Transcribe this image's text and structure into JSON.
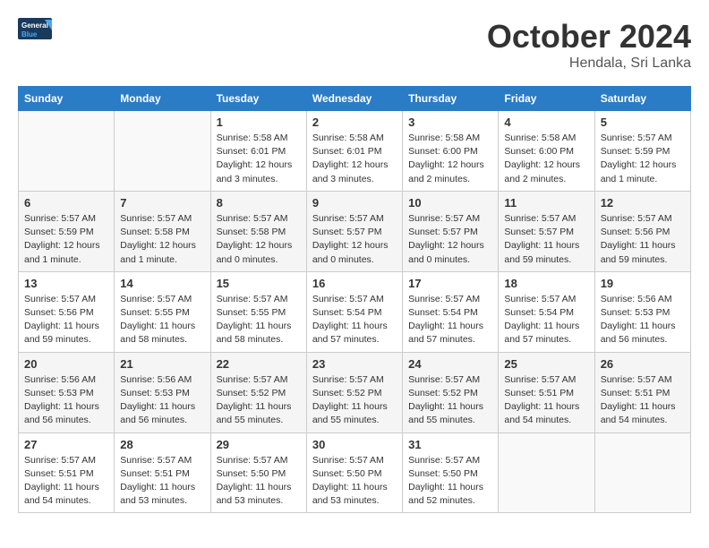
{
  "header": {
    "logo_line1": "General",
    "logo_line2": "Blue",
    "month": "October 2024",
    "location": "Hendala, Sri Lanka"
  },
  "days_of_week": [
    "Sunday",
    "Monday",
    "Tuesday",
    "Wednesday",
    "Thursday",
    "Friday",
    "Saturday"
  ],
  "weeks": [
    [
      {
        "day": "",
        "info": ""
      },
      {
        "day": "",
        "info": ""
      },
      {
        "day": "1",
        "info": "Sunrise: 5:58 AM\nSunset: 6:01 PM\nDaylight: 12 hours\nand 3 minutes."
      },
      {
        "day": "2",
        "info": "Sunrise: 5:58 AM\nSunset: 6:01 PM\nDaylight: 12 hours\nand 3 minutes."
      },
      {
        "day": "3",
        "info": "Sunrise: 5:58 AM\nSunset: 6:00 PM\nDaylight: 12 hours\nand 2 minutes."
      },
      {
        "day": "4",
        "info": "Sunrise: 5:58 AM\nSunset: 6:00 PM\nDaylight: 12 hours\nand 2 minutes."
      },
      {
        "day": "5",
        "info": "Sunrise: 5:57 AM\nSunset: 5:59 PM\nDaylight: 12 hours\nand 1 minute."
      }
    ],
    [
      {
        "day": "6",
        "info": "Sunrise: 5:57 AM\nSunset: 5:59 PM\nDaylight: 12 hours\nand 1 minute."
      },
      {
        "day": "7",
        "info": "Sunrise: 5:57 AM\nSunset: 5:58 PM\nDaylight: 12 hours\nand 1 minute."
      },
      {
        "day": "8",
        "info": "Sunrise: 5:57 AM\nSunset: 5:58 PM\nDaylight: 12 hours\nand 0 minutes."
      },
      {
        "day": "9",
        "info": "Sunrise: 5:57 AM\nSunset: 5:57 PM\nDaylight: 12 hours\nand 0 minutes."
      },
      {
        "day": "10",
        "info": "Sunrise: 5:57 AM\nSunset: 5:57 PM\nDaylight: 12 hours\nand 0 minutes."
      },
      {
        "day": "11",
        "info": "Sunrise: 5:57 AM\nSunset: 5:57 PM\nDaylight: 11 hours\nand 59 minutes."
      },
      {
        "day": "12",
        "info": "Sunrise: 5:57 AM\nSunset: 5:56 PM\nDaylight: 11 hours\nand 59 minutes."
      }
    ],
    [
      {
        "day": "13",
        "info": "Sunrise: 5:57 AM\nSunset: 5:56 PM\nDaylight: 11 hours\nand 59 minutes."
      },
      {
        "day": "14",
        "info": "Sunrise: 5:57 AM\nSunset: 5:55 PM\nDaylight: 11 hours\nand 58 minutes."
      },
      {
        "day": "15",
        "info": "Sunrise: 5:57 AM\nSunset: 5:55 PM\nDaylight: 11 hours\nand 58 minutes."
      },
      {
        "day": "16",
        "info": "Sunrise: 5:57 AM\nSunset: 5:54 PM\nDaylight: 11 hours\nand 57 minutes."
      },
      {
        "day": "17",
        "info": "Sunrise: 5:57 AM\nSunset: 5:54 PM\nDaylight: 11 hours\nand 57 minutes."
      },
      {
        "day": "18",
        "info": "Sunrise: 5:57 AM\nSunset: 5:54 PM\nDaylight: 11 hours\nand 57 minutes."
      },
      {
        "day": "19",
        "info": "Sunrise: 5:56 AM\nSunset: 5:53 PM\nDaylight: 11 hours\nand 56 minutes."
      }
    ],
    [
      {
        "day": "20",
        "info": "Sunrise: 5:56 AM\nSunset: 5:53 PM\nDaylight: 11 hours\nand 56 minutes."
      },
      {
        "day": "21",
        "info": "Sunrise: 5:56 AM\nSunset: 5:53 PM\nDaylight: 11 hours\nand 56 minutes."
      },
      {
        "day": "22",
        "info": "Sunrise: 5:57 AM\nSunset: 5:52 PM\nDaylight: 11 hours\nand 55 minutes."
      },
      {
        "day": "23",
        "info": "Sunrise: 5:57 AM\nSunset: 5:52 PM\nDaylight: 11 hours\nand 55 minutes."
      },
      {
        "day": "24",
        "info": "Sunrise: 5:57 AM\nSunset: 5:52 PM\nDaylight: 11 hours\nand 55 minutes."
      },
      {
        "day": "25",
        "info": "Sunrise: 5:57 AM\nSunset: 5:51 PM\nDaylight: 11 hours\nand 54 minutes."
      },
      {
        "day": "26",
        "info": "Sunrise: 5:57 AM\nSunset: 5:51 PM\nDaylight: 11 hours\nand 54 minutes."
      }
    ],
    [
      {
        "day": "27",
        "info": "Sunrise: 5:57 AM\nSunset: 5:51 PM\nDaylight: 11 hours\nand 54 minutes."
      },
      {
        "day": "28",
        "info": "Sunrise: 5:57 AM\nSunset: 5:51 PM\nDaylight: 11 hours\nand 53 minutes."
      },
      {
        "day": "29",
        "info": "Sunrise: 5:57 AM\nSunset: 5:50 PM\nDaylight: 11 hours\nand 53 minutes."
      },
      {
        "day": "30",
        "info": "Sunrise: 5:57 AM\nSunset: 5:50 PM\nDaylight: 11 hours\nand 53 minutes."
      },
      {
        "day": "31",
        "info": "Sunrise: 5:57 AM\nSunset: 5:50 PM\nDaylight: 11 hours\nand 52 minutes."
      },
      {
        "day": "",
        "info": ""
      },
      {
        "day": "",
        "info": ""
      }
    ]
  ]
}
